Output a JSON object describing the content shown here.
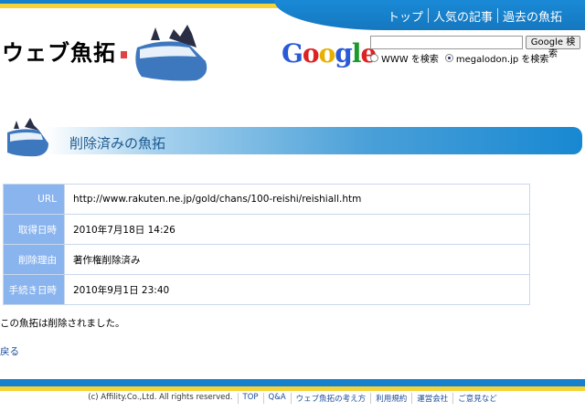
{
  "header": {
    "logo": "ウェブ魚拓",
    "nav": [
      "トップ",
      "人気の記事",
      "過去の魚拓"
    ]
  },
  "search": {
    "google_logo": "Google",
    "value": "",
    "button": "Google 検索",
    "options": [
      {
        "label": "WWW を検索",
        "selected": false
      },
      {
        "label": "megalodon.jp を検索",
        "selected": true
      }
    ]
  },
  "section_title": "削除済みの魚拓",
  "details": [
    {
      "label": "URL",
      "value": "http://www.rakuten.ne.jp/gold/chans/100-reishi/reishiall.htm"
    },
    {
      "label": "取得日時",
      "value": "2010年7月18日 14:26"
    },
    {
      "label": "削除理由",
      "value": "著作権削除済み"
    },
    {
      "label": "手続き日時",
      "value": "2010年9月1日 23:40"
    }
  ],
  "message": "この魚拓は削除されました。",
  "back_link": "戻る",
  "footer": {
    "copyright": "(c) Affility.Co.,Ltd. All rights reserved.",
    "links": [
      "TOP",
      "Q&A",
      "ウェブ魚拓の考え方",
      "利用規約",
      "運営会社",
      "ご意見など"
    ]
  },
  "colors": {
    "brand_blue": "#1680cc",
    "brand_yellow": "#f5d43a",
    "label_bg": "#8ab4ee",
    "link": "#1a4b9a"
  }
}
